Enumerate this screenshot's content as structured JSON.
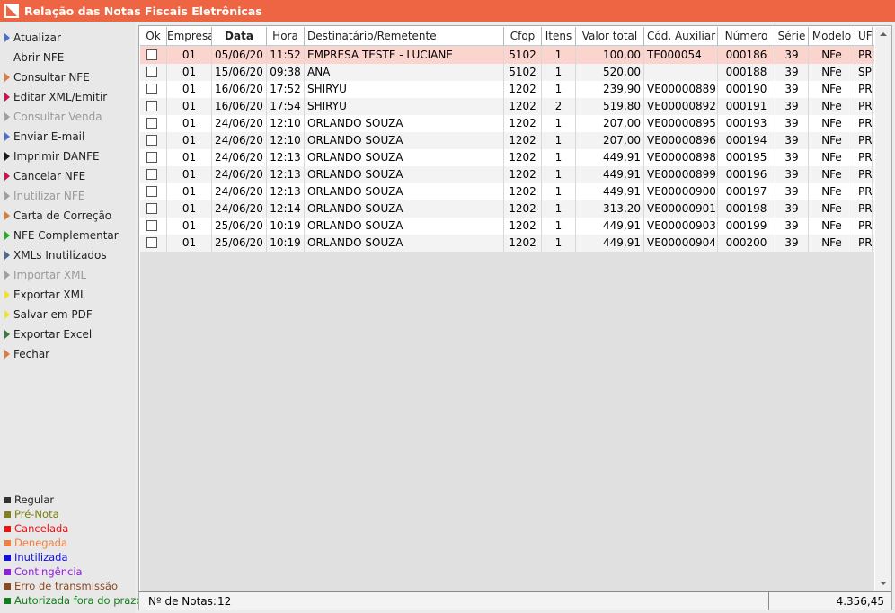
{
  "window": {
    "title": "Relação das Notas Fiscais Eletrônicas"
  },
  "sidebar": {
    "menu": [
      {
        "label": "Atualizar",
        "color": "#4a6fd0",
        "disabled": false,
        "name": "menu-atualizar"
      },
      {
        "label": "Abrir NFE",
        "color": "#e8e8e8",
        "disabled": false,
        "name": "menu-abrir-nfe"
      },
      {
        "label": "Consultar NFE",
        "color": "#e07a3a",
        "disabled": false,
        "name": "menu-consultar-nfe"
      },
      {
        "label": "Editar XML/Emitir",
        "color": "#d01050",
        "disabled": false,
        "name": "menu-editar-xml"
      },
      {
        "label": "Consultar Venda",
        "color": "#9aa0a6",
        "disabled": true,
        "name": "menu-consultar-venda"
      },
      {
        "label": "Enviar E-mail",
        "color": "#4a6fd0",
        "disabled": false,
        "name": "menu-enviar-email"
      },
      {
        "label": "Imprimir DANFE",
        "color": "#1a1a1a",
        "disabled": false,
        "name": "menu-imprimir-danfe"
      },
      {
        "label": "Cancelar NFE",
        "color": "#d01050",
        "disabled": false,
        "name": "menu-cancelar-nfe"
      },
      {
        "label": "Inutilizar NFE",
        "color": "#9aa0a6",
        "disabled": true,
        "name": "menu-inutilizar-nfe"
      },
      {
        "label": "Carta de Correção",
        "color": "#e07a3a",
        "disabled": false,
        "name": "menu-carta-correcao"
      },
      {
        "label": "NFE Complementar",
        "color": "#20b020",
        "disabled": false,
        "name": "menu-nfe-complementar"
      },
      {
        "label": "XMLs Inutilizados",
        "color": "#4a6a90",
        "disabled": false,
        "name": "menu-xmls-inutilizados"
      },
      {
        "label": "Importar XML",
        "color": "#9aa0a6",
        "disabled": true,
        "name": "menu-importar-xml"
      },
      {
        "label": "Exportar XML",
        "color": "#f0e030",
        "disabled": false,
        "name": "menu-exportar-xml"
      },
      {
        "label": "Salvar em PDF",
        "color": "#f0e030",
        "disabled": false,
        "name": "menu-salvar-pdf"
      },
      {
        "label": "Exportar Excel",
        "color": "#3a7a3a",
        "disabled": false,
        "name": "menu-exportar-excel"
      },
      {
        "label": "Fechar",
        "color": "#e07a3a",
        "disabled": false,
        "name": "menu-fechar"
      }
    ],
    "legend": [
      {
        "label": "Regular",
        "color": "#333333",
        "text_color": "#222222"
      },
      {
        "label": "Pré-Nota",
        "color": "#808020",
        "text_color": "#7a7a10"
      },
      {
        "label": "Cancelada",
        "color": "#ee1010",
        "text_color": "#ee1010"
      },
      {
        "label": "Denegada",
        "color": "#f08040",
        "text_color": "#f08040"
      },
      {
        "label": "Inutilizada",
        "color": "#1010e0",
        "text_color": "#1010e0"
      },
      {
        "label": "Contingência",
        "color": "#9020e0",
        "text_color": "#9020e0"
      },
      {
        "label": "Erro de transmissão",
        "color": "#8a4a20",
        "text_color": "#8a4a20"
      },
      {
        "label": "Autorizada fora do prazo",
        "color": "#10801a",
        "text_color": "#10801a"
      }
    ]
  },
  "table": {
    "columns": [
      "Ok",
      "Empresa",
      "Data",
      "Hora",
      "Destinatário/Remetente",
      "Cfop",
      "Itens",
      "Valor total",
      "Cód. Auxiliar",
      "Número",
      "Série",
      "Modelo",
      "UF"
    ],
    "rows": [
      [
        "01",
        "05/06/20",
        "11:52",
        "EMPRESA TESTE - LUCIANE",
        "5102",
        "1",
        "100,00",
        "TE000054",
        "000186",
        "39",
        "NFe",
        "PR"
      ],
      [
        "01",
        "15/06/20",
        "09:38",
        "ANA",
        "5102",
        "1",
        "520,00",
        "",
        "000188",
        "39",
        "NFe",
        "SP"
      ],
      [
        "01",
        "16/06/20",
        "17:52",
        "SHIRYU",
        "1202",
        "1",
        "239,90",
        "VE00000889",
        "000190",
        "39",
        "NFe",
        "PR"
      ],
      [
        "01",
        "16/06/20",
        "17:54",
        "SHIRYU",
        "1202",
        "2",
        "519,80",
        "VE00000892",
        "000191",
        "39",
        "NFe",
        "PR"
      ],
      [
        "01",
        "24/06/20",
        "12:10",
        "ORLANDO SOUZA",
        "1202",
        "1",
        "207,00",
        "VE00000895",
        "000193",
        "39",
        "NFe",
        "PR"
      ],
      [
        "01",
        "24/06/20",
        "12:10",
        "ORLANDO SOUZA",
        "1202",
        "1",
        "207,00",
        "VE00000896",
        "000194",
        "39",
        "NFe",
        "PR"
      ],
      [
        "01",
        "24/06/20",
        "12:13",
        "ORLANDO SOUZA",
        "1202",
        "1",
        "449,91",
        "VE00000898",
        "000195",
        "39",
        "NFe",
        "PR"
      ],
      [
        "01",
        "24/06/20",
        "12:13",
        "ORLANDO SOUZA",
        "1202",
        "1",
        "449,91",
        "VE00000899",
        "000196",
        "39",
        "NFe",
        "PR"
      ],
      [
        "01",
        "24/06/20",
        "12:13",
        "ORLANDO SOUZA",
        "1202",
        "1",
        "449,91",
        "VE00000900",
        "000197",
        "39",
        "NFe",
        "PR"
      ],
      [
        "01",
        "24/06/20",
        "12:14",
        "ORLANDO SOUZA",
        "1202",
        "1",
        "313,20",
        "VE00000901",
        "000198",
        "39",
        "NFe",
        "PR"
      ],
      [
        "01",
        "25/06/20",
        "10:19",
        "ORLANDO SOUZA",
        "1202",
        "1",
        "449,91",
        "VE00000903",
        "000199",
        "39",
        "NFe",
        "PR"
      ],
      [
        "01",
        "25/06/20",
        "10:19",
        "ORLANDO SOUZA",
        "1202",
        "1",
        "449,91",
        "VE00000904",
        "000200",
        "39",
        "NFe",
        "PR"
      ]
    ],
    "selected_row": 0
  },
  "footer": {
    "count_label": "Nº de Notas:",
    "count_value": "12",
    "total": "4.356,45"
  }
}
